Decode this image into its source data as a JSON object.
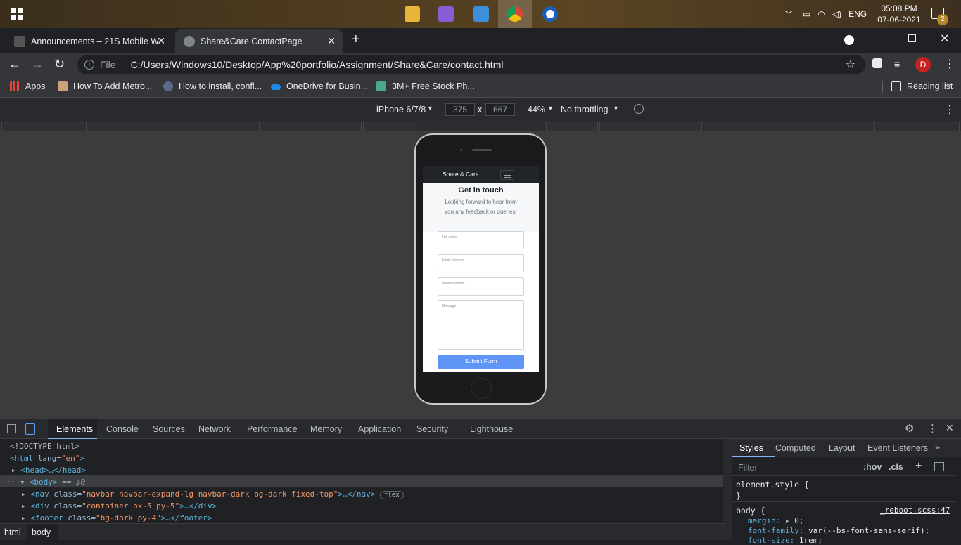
{
  "taskbar": {
    "time": "05:08 PM",
    "date": "07-06-2021",
    "lang": "ENG",
    "notif_count": "2",
    "apps": [
      "file-explorer-icon",
      "visual-studio-icon",
      "control-panel-icon",
      "chrome-icon",
      "word-icon"
    ]
  },
  "browser": {
    "tabs": [
      {
        "label": "Announcements – 21S Mobile W",
        "close": "✕"
      },
      {
        "label": "Share&Care ContactPage",
        "close": "✕"
      }
    ],
    "new_tab": "+",
    "url_prefix": "File",
    "url": "C:/Users/Windows10/Desktop/App%20portfolio/Assignment/Share&Care/contact.html",
    "profile_letter": "D",
    "bookmarks": [
      "Apps",
      "How To Add Metro...",
      "How to install, confi...",
      "OneDrive for Busin...",
      "3M+ Free Stock Ph..."
    ],
    "reading_list": "Reading list"
  },
  "device_toolbar": {
    "device": "iPhone 6/7/8",
    "width": "375",
    "height": "667",
    "times": "x",
    "zoom": "44%",
    "throttling": "No throttling"
  },
  "site": {
    "brand": "Share & Care",
    "heading": "Get in touch",
    "subtext_line1": "Looking forward to hear from",
    "subtext_line2": "you any feedback or queries!",
    "fields": {
      "name": "Full name",
      "email": "Email address",
      "phone": "Phone number",
      "message": "Message"
    },
    "submit": "Submit Form"
  },
  "devtools": {
    "tabs": [
      "Elements",
      "Console",
      "Sources",
      "Network",
      "Performance",
      "Memory",
      "Application",
      "Security",
      "Lighthouse"
    ],
    "active_tab": "Elements",
    "dom": {
      "doctype": "<!DOCTYPE html>",
      "html_open": "<html",
      "lang_attr": "lang",
      "lang_val": "\"en\"",
      "close": ">",
      "head": "<head>…</head>",
      "body_line": "<body>",
      "body_marker": "== $0",
      "nav_tag": "<nav",
      "nav_class": "\"navbar navbar-expand-lg navbar-dark bg-dark fixed-top\"",
      "nav_end": ">…</nav>",
      "flex_badge": "flex",
      "div_tag": "<div",
      "div_class": "\"container px-5 py-5\"",
      "div_end": ">…</div>",
      "footer_tag": "<footer",
      "footer_class": "\"bg-dark py-4\"",
      "footer_end": ">…</footer>",
      "class_attr": "class="
    },
    "breadcrumbs": [
      "html",
      "body"
    ],
    "styles_tabs": [
      "Styles",
      "Computed",
      "Layout",
      "Event Listeners"
    ],
    "filter_placeholder": "Filter",
    "hov": ":hov",
    "cls": ".cls",
    "element_style": "element.style {",
    "brace_close": "}",
    "rule_selector": "body {",
    "rule_source": "_reboot.scss:47",
    "prop1": "margin:",
    "val1": "0;",
    "prop2": "font-family:",
    "val2": "var(--bs-font-sans-serif);",
    "prop3": "font-size:",
    "val3": "1rem;"
  },
  "colors": {
    "accent_blue": "#5f95f7",
    "profile": "#c5221f"
  }
}
